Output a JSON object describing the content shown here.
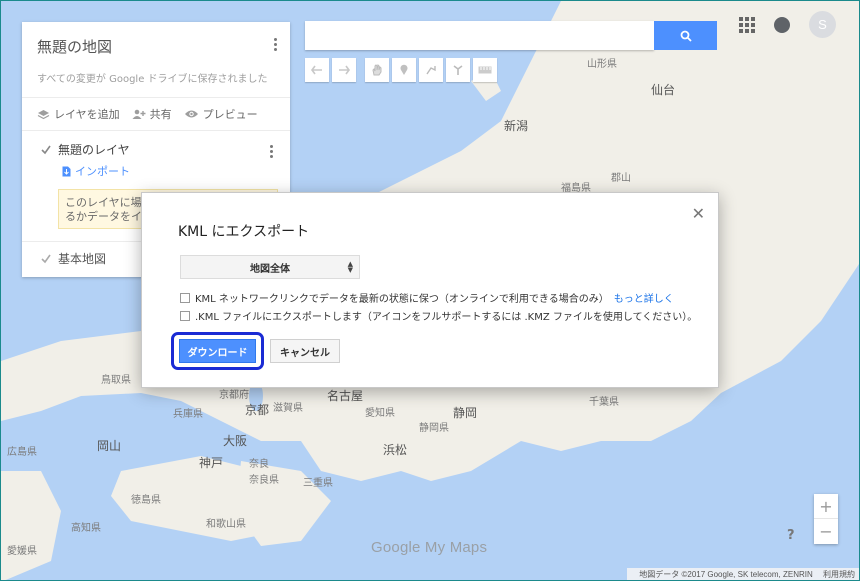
{
  "map": {
    "labels": {
      "yamagata": "山形県",
      "sendai": "仙台",
      "niigata": "新潟",
      "fukushima": "福島県",
      "koriyama": "郡山",
      "nagoya": "名古屋",
      "kyoto_pref": "京都府",
      "kyoto": "京都",
      "shiga": "滋賀県",
      "aichi": "愛知県",
      "shizuoka": "静岡",
      "shizuoka_pref": "静岡県",
      "hyogo": "兵庫県",
      "osaka": "大阪",
      "kobe": "神戸",
      "nara_city": "奈良",
      "nara_pref": "奈良県",
      "mie": "三重県",
      "hamamatsu": "浜松",
      "okayama": "岡山",
      "hiroshima": "広島県",
      "wakayama": "和歌山県",
      "tokushima": "徳島県",
      "kochi": "高知県",
      "ehime": "愛媛県",
      "chiba": "千葉県",
      "tottori": "鳥取県"
    },
    "watermark": "Google My Maps",
    "footer_data": "地図データ ©2017 Google, SK telecom, ZENRIN",
    "footer_terms": "利用規約"
  },
  "top_right": {
    "avatar_letter": "S"
  },
  "panel": {
    "title": "無題の地図",
    "subtitle": "すべての変更が Google ドライブに保存されました",
    "actions": {
      "add_layer": "レイヤを追加",
      "share": "共有",
      "preview": "プレビュー"
    },
    "layer_name": "無題のレイヤ",
    "import_label": "インポート",
    "hint_line1": "このレイヤに場所",
    "hint_line2": "るかデータをイン",
    "base_map": "基本地図"
  },
  "dialog": {
    "title": "KML にエクスポート",
    "select_value": "地図全体",
    "option1_text": "KML ネットワークリンクでデータを最新の状態に保つ（オンラインで利用できる場合のみ）",
    "option1_link": "もっと詳しく",
    "option2_text": ".KML ファイルにエクスポートします（アイコンをフルサポートするには .KMZ ファイルを使用してください）。",
    "download_label": "ダウンロード",
    "cancel_label": "キャンセル"
  },
  "zoom": {
    "in": "+",
    "out": "−"
  },
  "help": "?"
}
